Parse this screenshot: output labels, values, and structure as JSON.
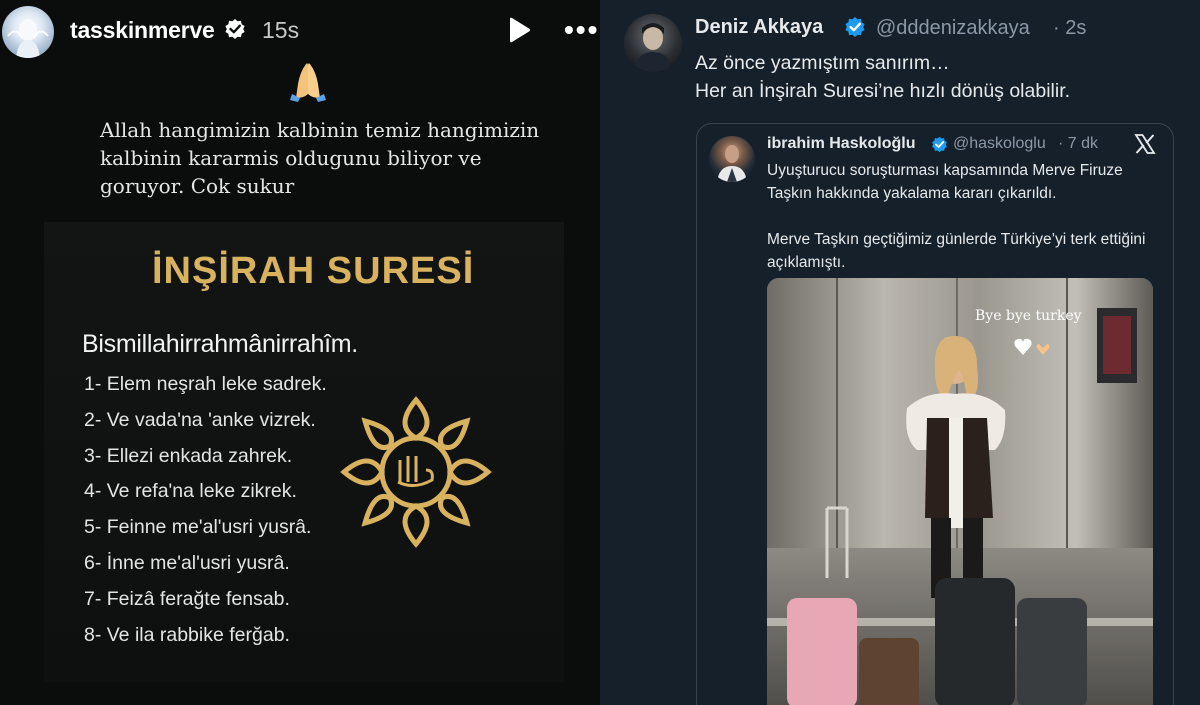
{
  "story": {
    "username": "tasskinmerve",
    "time": "15s",
    "caption": "Allah hangimizin kalbinin temiz hangimizin kalbinin kararmis oldugunu biliyor ve goruyor. Cok sukur",
    "title": "İNŞİRAH SURESİ",
    "subtitle": "Bismillahirrahmânirrahîm.",
    "verses": [
      "1- Elem neşrah leke sadrek.",
      "2- Ve vada'na 'anke vizrek.",
      "3- Ellezi enkada zahrek.",
      "4- Ve refa'na leke zikrek.",
      "5- Feinne me'al'usri yusrâ.",
      "6- İnne me'al'usri yusrâ.",
      "7- Feizâ ferağte fensab.",
      "8- Ve ila rabbike ferğab."
    ],
    "icons": [
      "verified-badge-icon",
      "play-icon",
      "more-icon",
      "praying-hands-emoji",
      "allah-calligraphy-ornament"
    ],
    "colors": {
      "background": "#0b0d0c",
      "title_gold": "#d8b25e"
    }
  },
  "tweet": {
    "name": "Deniz Akkaya",
    "handle": "@dddenizakkaya",
    "time": "· 2s",
    "text_lines": [
      "Az önce yazmıştım sanırım…",
      "Her an İnşirah Suresi’ne hızlı dönüş olabilir."
    ],
    "colors": {
      "background": "#15202b",
      "verified": "#1d9bf0",
      "muted": "#8b98a5"
    },
    "quote": {
      "name": "ibrahim Haskoloğlu",
      "handle": "@haskologlu",
      "time": "· 7 dk",
      "paragraphs": [
        "Uyuşturucu soruşturması kapsamında Merve Firuze Taşkın hakkında yakalama kararı çıkarıldı.",
        "Merve Taşkın geçtiğimiz günlerde Türkiye’yi terk ettiğini açıklamıştı."
      ],
      "media": {
        "caption": "Bye bye turkey"
      }
    }
  }
}
